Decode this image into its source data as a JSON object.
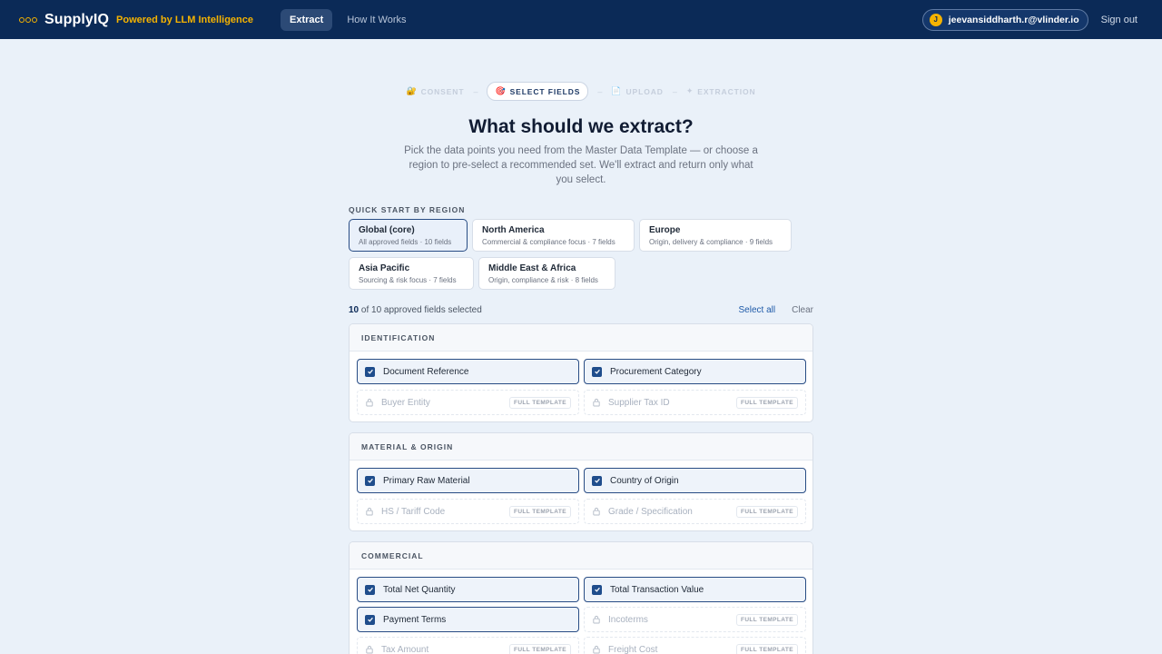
{
  "header": {
    "brand": "SupplyIQ",
    "tagline": "Powered by LLM Intelligence",
    "nav": [
      "Extract",
      "How It Works"
    ],
    "user": {
      "initial": "J",
      "email": "jeevansiddharth.r@vlinder.io"
    },
    "signout": "Sign out"
  },
  "stepper": {
    "steps": [
      {
        "icon": "🔐",
        "label": "CONSENT"
      },
      {
        "icon": "🎯",
        "label": "SELECT FIELDS"
      },
      {
        "icon": "📄",
        "label": "UPLOAD"
      },
      {
        "icon": "✦",
        "label": "EXTRACTION"
      }
    ]
  },
  "main": {
    "title": "What should we extract?",
    "subtitle": "Pick the data points you need from the Master Data Template — or choose a region to pre-select a recommended set. We'll extract and return only what you select."
  },
  "regions": {
    "heading": "QUICK START BY REGION",
    "items": [
      {
        "name": "Global (core)",
        "desc": "All approved fields · 10 fields"
      },
      {
        "name": "North America",
        "desc": "Commercial & compliance focus · 7 fields"
      },
      {
        "name": "Europe",
        "desc": "Origin, delivery & compliance · 9 fields"
      },
      {
        "name": "Asia Pacific",
        "desc": "Sourcing & risk focus · 7 fields"
      },
      {
        "name": "Middle East & Africa",
        "desc": "Origin, compliance & risk · 8 fields"
      }
    ]
  },
  "selection": {
    "count": "10",
    "rest": "of 10 approved fields selected",
    "select_all": "Select all",
    "clear": "Clear"
  },
  "sections": [
    {
      "title": "IDENTIFICATION",
      "fields": [
        {
          "label": "Document Reference"
        },
        {
          "label": "Procurement Category"
        },
        {
          "label": "Buyer Entity",
          "badge": "FULL TEMPLATE"
        },
        {
          "label": "Supplier Tax ID",
          "badge": "FULL TEMPLATE"
        }
      ]
    },
    {
      "title": "MATERIAL & ORIGIN",
      "fields": [
        {
          "label": "Primary Raw Material"
        },
        {
          "label": "Country of Origin"
        },
        {
          "label": "HS / Tariff Code",
          "badge": "FULL TEMPLATE"
        },
        {
          "label": "Grade / Specification",
          "badge": "FULL TEMPLATE"
        }
      ]
    },
    {
      "title": "COMMERCIAL",
      "fields": [
        {
          "label": "Total Net Quantity"
        },
        {
          "label": "Total Transaction Value"
        },
        {
          "label": "Payment Terms"
        },
        {
          "label": "Incoterms",
          "badge": "FULL TEMPLATE"
        },
        {
          "label": "Tax Amount",
          "badge": "FULL TEMPLATE"
        },
        {
          "label": "Freight Cost",
          "badge": "FULL TEMPLATE"
        }
      ]
    }
  ],
  "colors": {
    "navy": "#0b2a57",
    "accent": "#f5b301",
    "background": "#eaf1f9",
    "link": "#1e5aa8"
  }
}
